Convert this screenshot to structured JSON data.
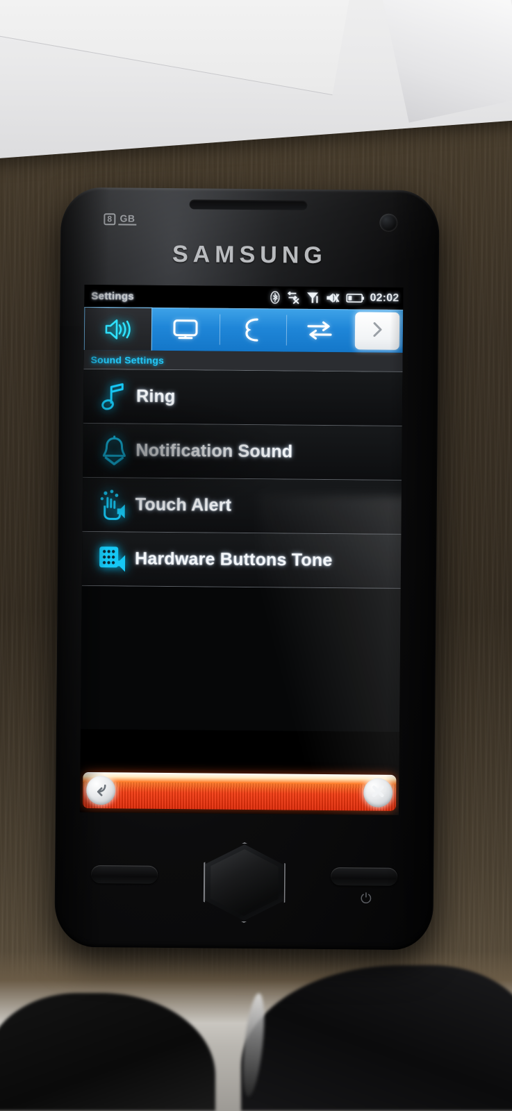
{
  "device": {
    "brand": "SAMSUNG",
    "storage_badge_number": "8",
    "storage_badge_unit": "GB",
    "hardware_buttons": {
      "call_button": "Call",
      "home_button": "Home",
      "end_button": "End / Power"
    }
  },
  "statusbar": {
    "title": "Settings",
    "time": "02:02",
    "icons": [
      {
        "name": "bluetooth-icon",
        "label": "Bluetooth"
      },
      {
        "name": "data-transfer-off-icon",
        "label": "Data transfer off"
      },
      {
        "name": "signal-strength-icon",
        "label": "Signal strength"
      },
      {
        "name": "sound-off-icon",
        "label": "Silent mode"
      },
      {
        "name": "battery-icon",
        "label": "Battery"
      }
    ]
  },
  "tabs": {
    "items": [
      {
        "label": "Sound",
        "icon": "speaker-icon",
        "active": true
      },
      {
        "label": "Display",
        "icon": "monitor-icon",
        "active": false
      },
      {
        "label": "Call",
        "icon": "handset-icon",
        "active": false
      },
      {
        "label": "Connectivity",
        "icon": "transfer-arrows-icon",
        "active": false
      }
    ],
    "next_button": {
      "label": "Next",
      "icon": "chevron-right-icon"
    }
  },
  "section": {
    "header": "Sound Settings"
  },
  "list": {
    "rows": [
      {
        "label": "Ring",
        "icon": "music-note-icon"
      },
      {
        "label": "Notification Sound",
        "icon": "bell-icon"
      },
      {
        "label": "Touch Alert",
        "icon": "touch-speaker-icon"
      },
      {
        "label": "Hardware Buttons Tone",
        "icon": "keypad-speaker-icon"
      }
    ]
  },
  "bottombar": {
    "back_button": {
      "label": "Back",
      "icon": "back-arrow-icon"
    },
    "close_button": {
      "label": "Close",
      "icon": "close-x-icon"
    }
  },
  "colors": {
    "accent_cyan": "#25c7f7",
    "tab_blue": "#1f86d8",
    "bottom_red": "#f33c12",
    "text_white": "#f4f7fa",
    "screen_black": "#000000"
  }
}
